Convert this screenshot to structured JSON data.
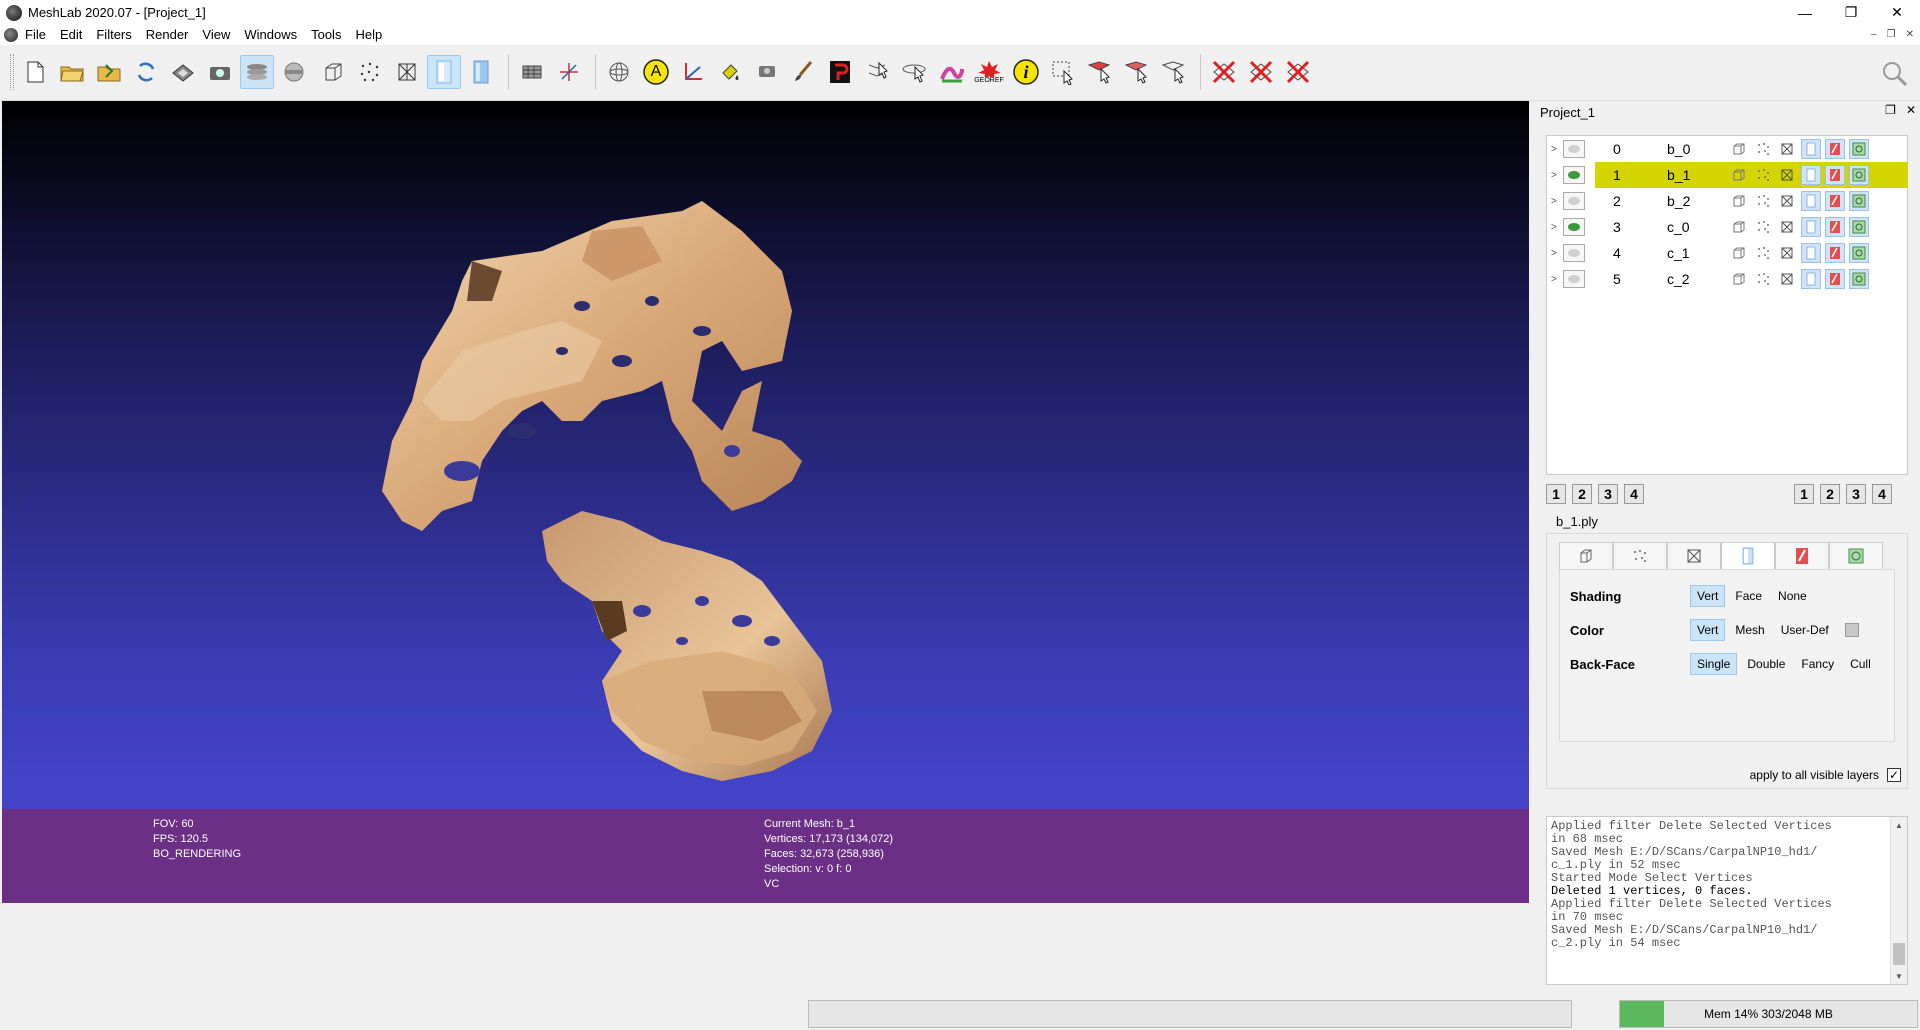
{
  "window": {
    "title": "MeshLab 2020.07 - [Project_1]",
    "controls": {
      "minimize": "—",
      "restore": "❐",
      "close": "✕"
    },
    "mdi_controls": {
      "minimize": "–",
      "restore": "❐",
      "close": "✕"
    }
  },
  "menu": [
    "File",
    "Edit",
    "Filters",
    "Render",
    "View",
    "Windows",
    "Tools",
    "Help"
  ],
  "toolbar": {
    "georef_label": "GEOREF",
    "annotate_letter": "A",
    "info_letter": "i"
  },
  "viewport": {
    "background_top": "#000000",
    "background_bottom": "#4a4ad8",
    "info_left": [
      "FOV: 60",
      "FPS:   120.5",
      "BO_RENDERING"
    ],
    "info_mid": [
      "Current Mesh: b_1",
      "Vertices: 17,173    (134,072)",
      "Faces: 32,673    (258,936)",
      "Selection: v: 0 f: 0",
      "VC"
    ]
  },
  "dock": {
    "title": "Project_1",
    "layers": [
      {
        "id": "0",
        "name": "b_0",
        "selected": false,
        "eye_color": "#d0d0d0"
      },
      {
        "id": "1",
        "name": "b_1",
        "selected": true,
        "eye_color": "#3a9a3a"
      },
      {
        "id": "2",
        "name": "b_2",
        "selected": false,
        "eye_color": "#d0d0d0"
      },
      {
        "id": "3",
        "name": "c_0",
        "selected": false,
        "eye_color": "#3a9a3a"
      },
      {
        "id": "4",
        "name": "c_1",
        "selected": false,
        "eye_color": "#d0d0d0"
      },
      {
        "id": "5",
        "name": "c_2",
        "selected": false,
        "eye_color": "#d0d0d0"
      }
    ],
    "left_numbers": [
      "1",
      "2",
      "3",
      "4"
    ],
    "right_numbers": [
      "1",
      "2",
      "3",
      "4"
    ],
    "current_file": "b_1.ply",
    "render": {
      "shading": {
        "label": "Shading",
        "options": [
          "Vert",
          "Face",
          "None"
        ],
        "selected": "Vert"
      },
      "color": {
        "label": "Color",
        "options": [
          "Vert",
          "Mesh",
          "User-Def"
        ],
        "selected": "Vert"
      },
      "backface": {
        "label": "Back-Face",
        "options": [
          "Single",
          "Double",
          "Fancy",
          "Cull"
        ],
        "selected": "Single"
      },
      "apply_all": "apply to all visible layers",
      "apply_checked": "✓"
    },
    "log": [
      {
        "text": "Applied filter Delete Selected Vertices",
        "bold": false
      },
      {
        "text": "in 68 msec",
        "bold": false
      },
      {
        "text": "Saved Mesh E:/D/SCans/CarpalNP10_hd1/",
        "bold": false
      },
      {
        "text": "c_1.ply in 52 msec",
        "bold": false
      },
      {
        "text": "Started Mode Select Vertices",
        "bold": false
      },
      {
        "text": "Deleted 1 vertices, 0 faces.",
        "bold": true
      },
      {
        "text": "Applied filter Delete Selected Vertices",
        "bold": false
      },
      {
        "text": "in 70 msec",
        "bold": false
      },
      {
        "text": "Saved Mesh E:/D/SCans/CarpalNP10_hd1/",
        "bold": false
      },
      {
        "text": "c_2.ply in 54 msec",
        "bold": false
      }
    ]
  },
  "status": {
    "mem_text": "Mem 14% 303/2048 MB",
    "mem_fraction": 0.148,
    "mem_color": "#5cb85c"
  }
}
